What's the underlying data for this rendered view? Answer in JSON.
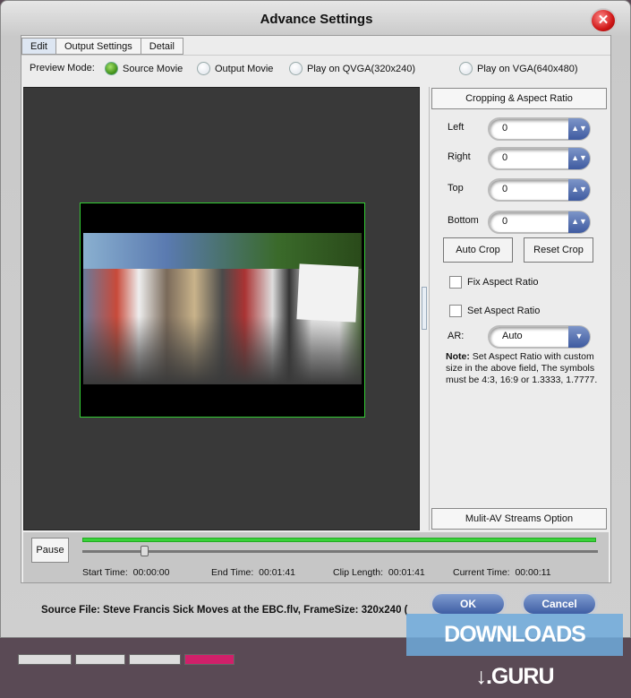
{
  "window": {
    "title": "Advance Settings",
    "close_icon": "close-icon"
  },
  "tabs": [
    {
      "label": "Edit",
      "active": true
    },
    {
      "label": "Output Settings"
    },
    {
      "label": "Detail"
    }
  ],
  "preview_mode": {
    "label": "Preview Mode:",
    "options": [
      {
        "label": "Source Movie",
        "selected": true
      },
      {
        "label": "Output Movie"
      },
      {
        "label": "Play on QVGA(320x240)"
      },
      {
        "label": "Play on VGA(640x480)"
      }
    ]
  },
  "crop": {
    "title": "Cropping & Aspect Ratio",
    "fields": [
      {
        "label": "Left",
        "value": "0"
      },
      {
        "label": "Right",
        "value": "0"
      },
      {
        "label": "Top",
        "value": "0"
      },
      {
        "label": "Bottom",
        "value": "0"
      }
    ],
    "auto_crop": "Auto Crop",
    "reset_crop": "Reset Crop",
    "fix_aspect": "Fix Aspect Ratio",
    "set_aspect": "Set Aspect Ratio",
    "ar_label": "AR:",
    "ar_value": "Auto",
    "note_bold": "Note:",
    "note": " Set Aspect Ratio with custom size in the above field, The symbols must be 4:3, 16:9 or 1.3333, 1.7777."
  },
  "multi_av": "Mulit-AV Streams Option",
  "playback": {
    "pause": "Pause",
    "position_fraction": 0.12,
    "start_label": "Start Time:",
    "start": "00:00:00",
    "end_label": "End Time:",
    "end": "00:01:41",
    "clip_label": "Clip Length:",
    "clip": "00:01:41",
    "current_label": "Current Time:",
    "current": "00:00:11"
  },
  "footer": {
    "source": "Source File: Steve Francis Sick Moves at the EBC.flv, FrameSize: 320x240 (",
    "ok": "OK",
    "cancel": "Cancel"
  },
  "watermark": "DOWNLOADS ↓.GURU",
  "colors": {
    "progress": "#3ad13a",
    "button_blue": "#3f5ea4"
  }
}
